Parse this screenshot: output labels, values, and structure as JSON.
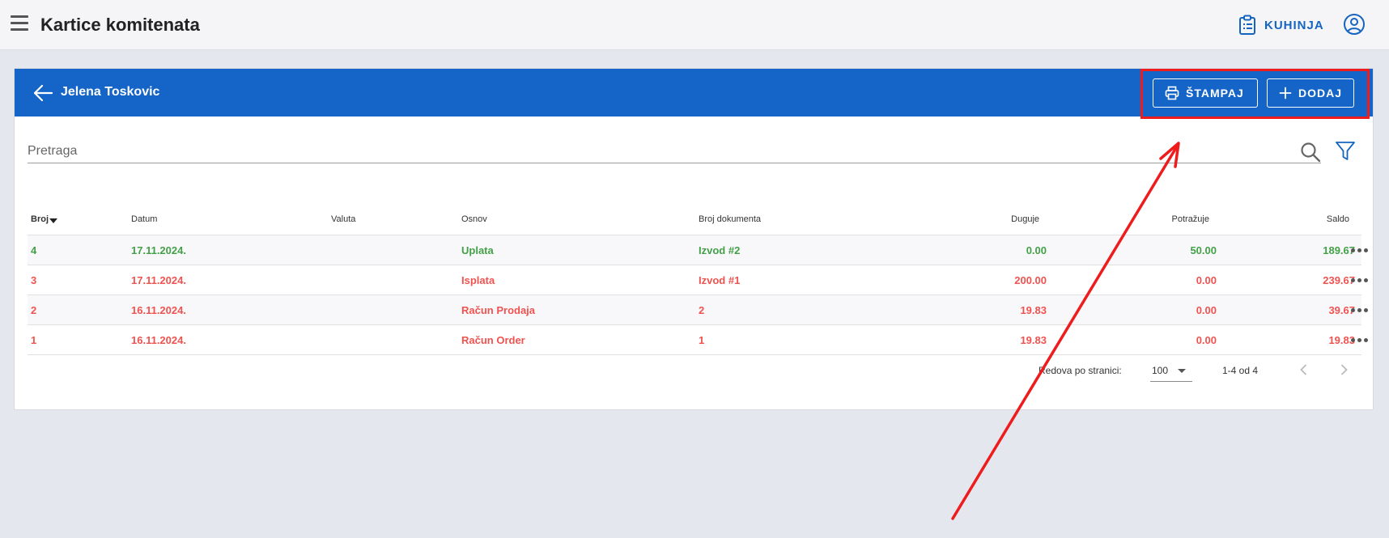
{
  "topbar": {
    "title": "Kartice komitenata",
    "kitchen_label": "KUHINJA"
  },
  "card": {
    "client_name": "Jelena Toskovic",
    "print_label": "ŠTAMPAJ",
    "add_label": "DODAJ"
  },
  "search": {
    "placeholder": "Pretraga"
  },
  "table": {
    "headers": {
      "broj": "Broj",
      "datum": "Datum",
      "valuta": "Valuta",
      "osnov": "Osnov",
      "broj_dokumenta": "Broj dokumenta",
      "duguje": "Duguje",
      "potrazuje": "Potražuje",
      "saldo": "Saldo"
    },
    "rows": [
      {
        "broj": "4",
        "datum": "17.11.2024.",
        "valuta": "",
        "osnov": "Uplata",
        "broj_dokumenta": "Izvod #2",
        "duguje": "0.00",
        "potrazuje": "50.00",
        "saldo": "189.67",
        "status": "green"
      },
      {
        "broj": "3",
        "datum": "17.11.2024.",
        "valuta": "",
        "osnov": "Isplata",
        "broj_dokumenta": "Izvod #1",
        "duguje": "200.00",
        "potrazuje": "0.00",
        "saldo": "239.67",
        "status": "red"
      },
      {
        "broj": "2",
        "datum": "16.11.2024.",
        "valuta": "",
        "osnov": "Račun Prodaja",
        "broj_dokumenta": "2",
        "duguje": "19.83",
        "potrazuje": "0.00",
        "saldo": "39.67",
        "status": "red"
      },
      {
        "broj": "1",
        "datum": "16.11.2024.",
        "valuta": "",
        "osnov": "Račun Order",
        "broj_dokumenta": "1",
        "duguje": "19.83",
        "potrazuje": "0.00",
        "saldo": "19.83",
        "status": "red"
      }
    ]
  },
  "pagination": {
    "rows_per_page_label": "Redova po stranici:",
    "rows_per_page_value": "100",
    "range_text": "1-4 od 4"
  },
  "colors": {
    "brand_blue": "#1565c8",
    "positive_green": "#43a047",
    "negative_red": "#ef5350",
    "annotation_red": "#ee1c1c"
  },
  "icons": [
    "menu-icon",
    "clipboard-list-icon",
    "account-circle-icon",
    "arrow-left-icon",
    "printer-icon",
    "plus-icon",
    "search-icon",
    "filter-icon",
    "more-horizontal-icon",
    "chevron-left-icon",
    "chevron-right-icon"
  ]
}
